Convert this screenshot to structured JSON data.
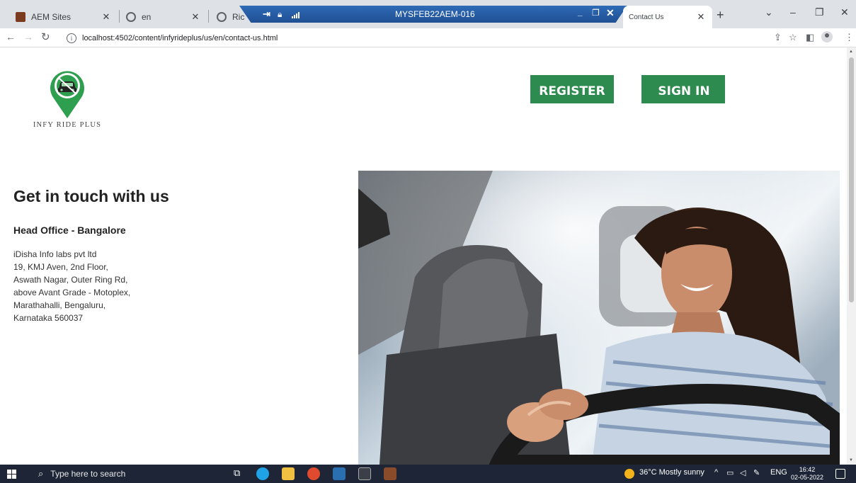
{
  "browser": {
    "tabs": [
      {
        "title": "AEM Sites",
        "close": "✕"
      },
      {
        "title": "en",
        "close": "✕"
      },
      {
        "title": "Ric",
        "close": ""
      },
      {
        "title": "Contact Us",
        "close": "✕"
      }
    ],
    "remote_session_title": "MYSFEB22AEM-016",
    "new_tab": "+",
    "url": "localhost:4502/content/infyrideplus/us/en/contact-us.html"
  },
  "site": {
    "logo_text": "INFY RIDE PLUS",
    "register_label": "REGISTER",
    "signin_label": "SIGN IN",
    "brand_color": "#2e8b4f"
  },
  "contact": {
    "heading": "Get in touch with us",
    "office_title": "Head Office - Bangalore",
    "address_lines": [
      "iDisha  Info labs pvt ltd",
      "19, KMJ Aven, 2nd Floor,",
      "Aswath Nagar, Outer Ring Rd,",
      "above Avant Grade - Motoplex,",
      "Marathahalli, Bengaluru,",
      "Karnataka 560037"
    ]
  },
  "taskbar": {
    "search_placeholder": "Type here to search",
    "weather": "36°C  Mostly sunny",
    "language": "ENG",
    "time": "16:42",
    "date": "02-05-2022"
  }
}
